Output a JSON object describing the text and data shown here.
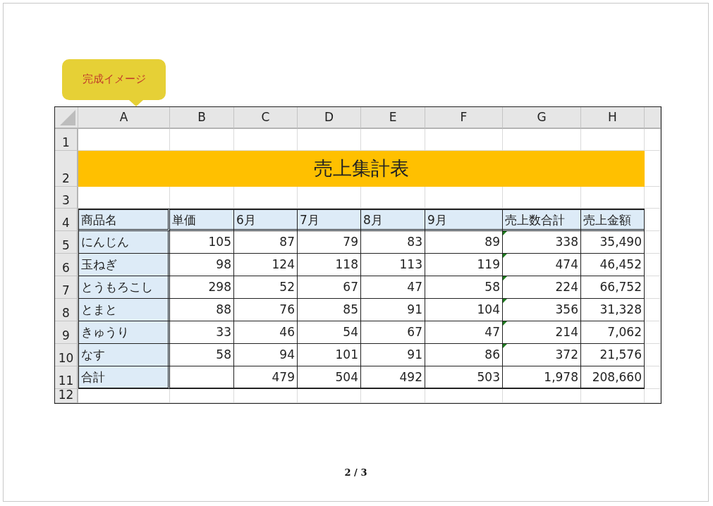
{
  "callout": {
    "text": "完成イメージ"
  },
  "sheet": {
    "columns": [
      "A",
      "B",
      "C",
      "D",
      "E",
      "F",
      "G",
      "H"
    ],
    "row_numbers": [
      "1",
      "2",
      "3",
      "4",
      "5",
      "6",
      "7",
      "8",
      "9",
      "10",
      "11",
      "12"
    ],
    "title": "売上集計表",
    "headers": [
      "商品名",
      "単価",
      "6月",
      "7月",
      "8月",
      "9月",
      "売上数合計",
      "売上金額"
    ],
    "rows": [
      {
        "cells": [
          "にんじん",
          "105",
          "87",
          "79",
          "83",
          "89",
          "338",
          "35,490"
        ],
        "error_indicator": true
      },
      {
        "cells": [
          "玉ねぎ",
          "98",
          "124",
          "118",
          "113",
          "119",
          "474",
          "46,452"
        ],
        "error_indicator": true
      },
      {
        "cells": [
          "とうもろこし",
          "298",
          "52",
          "67",
          "47",
          "58",
          "224",
          "66,752"
        ],
        "error_indicator": true
      },
      {
        "cells": [
          "とまと",
          "88",
          "76",
          "85",
          "91",
          "104",
          "356",
          "31,328"
        ],
        "error_indicator": true
      },
      {
        "cells": [
          "きゅうり",
          "33",
          "46",
          "54",
          "67",
          "47",
          "214",
          "7,062"
        ],
        "error_indicator": true
      },
      {
        "cells": [
          "なす",
          "58",
          "94",
          "101",
          "91",
          "86",
          "372",
          "21,576"
        ],
        "error_indicator": true
      },
      {
        "cells": [
          "合計",
          null,
          "479",
          "504",
          "492",
          "503",
          "1,978",
          "208,660"
        ],
        "error_indicator": false
      }
    ]
  },
  "page_indicator": "2 / 3"
}
